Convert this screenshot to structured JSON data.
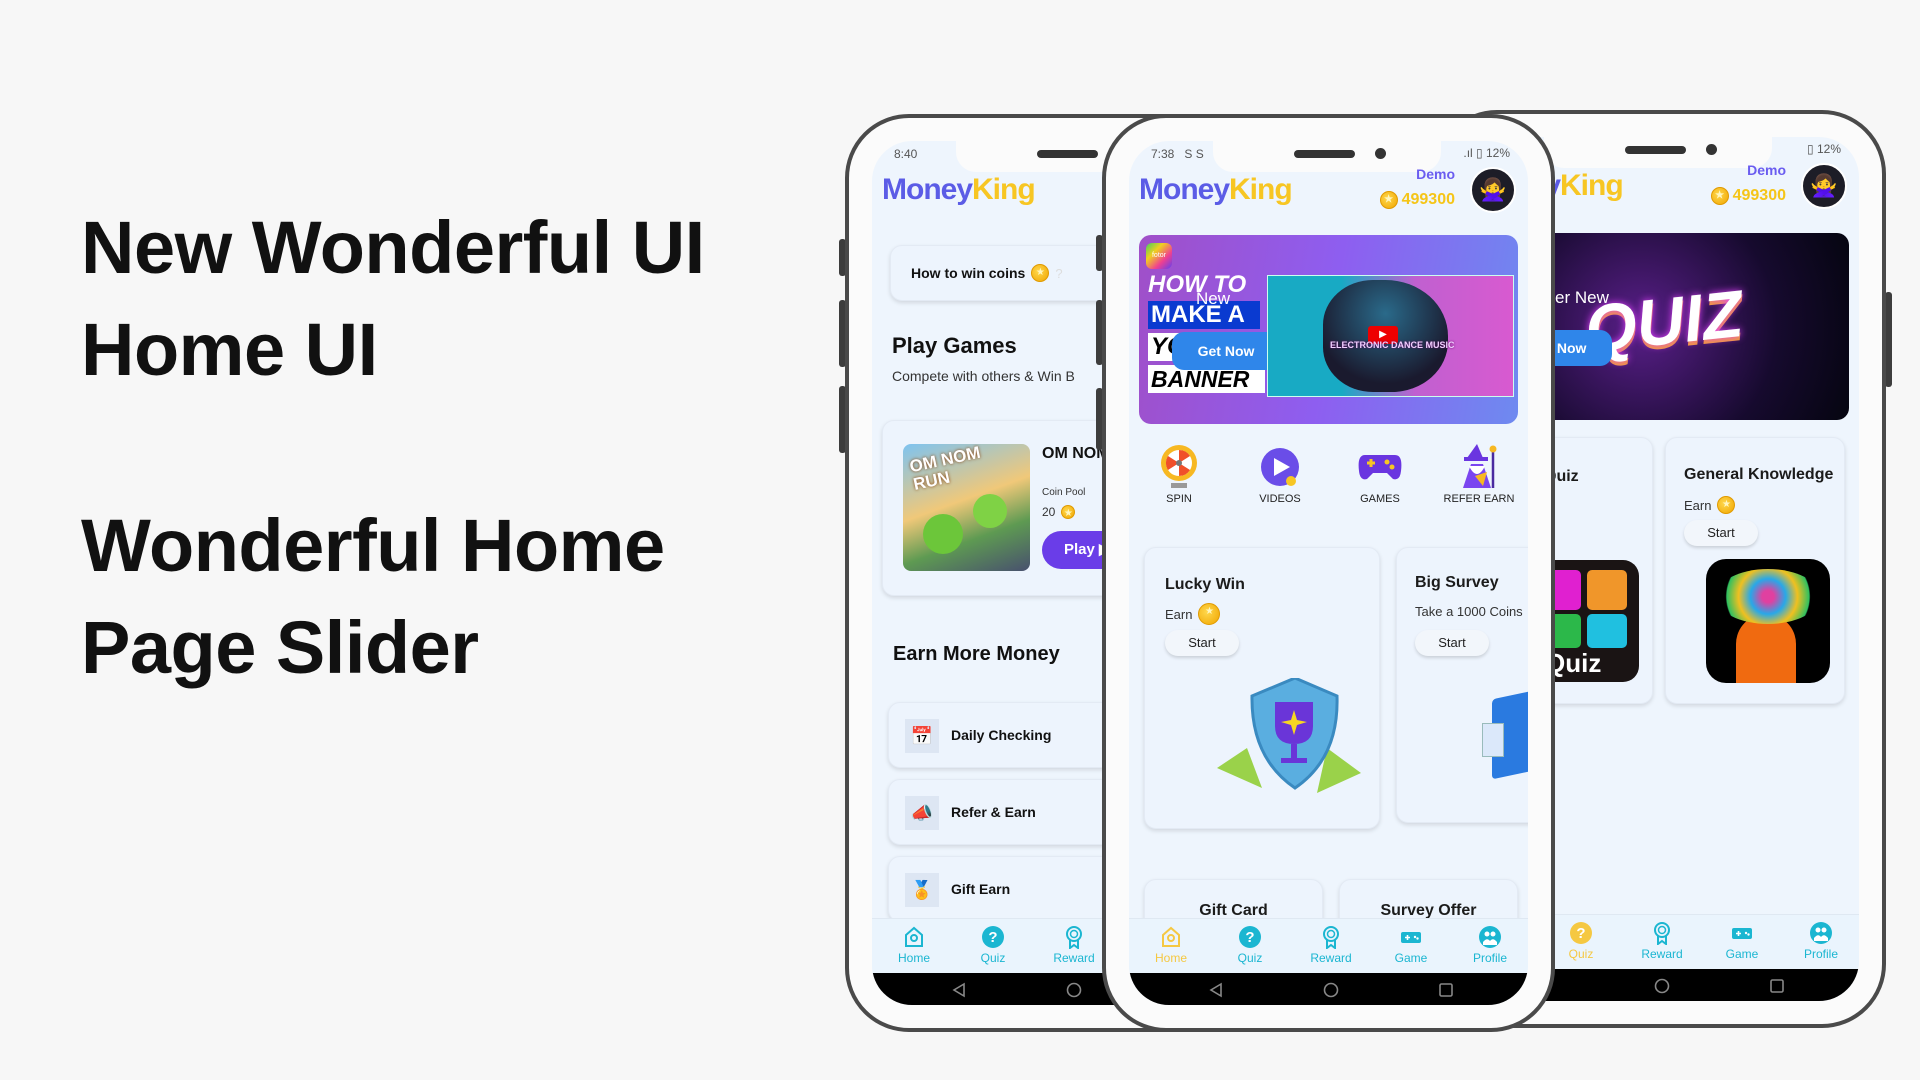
{
  "headline": {
    "line1": "New Wonderful UI",
    "line2": "Home UI",
    "line3": "Wonderful Home",
    "line4": "Page Slider"
  },
  "app": {
    "logo_part1": "Money",
    "logo_part2": "King",
    "user_name": "Demo",
    "coins": "499300",
    "avatar_icon": "person-gesturing-no-emoji",
    "colors": {
      "logo_money": "#5b5ce6",
      "logo_king": "#f7c623",
      "nav_teal": "#1bb6d1",
      "nav_active": "#f5c842",
      "play_button": "#6a3de8",
      "get_now_button": "#2f86ea",
      "screen_bg": "#eef5fd"
    }
  },
  "nav": [
    "Home",
    "Quiz",
    "Reward",
    "Game",
    "Profile"
  ],
  "left_phone": {
    "time": "8:40",
    "how_to_win": "How to win coins",
    "how_to_win_suffix": "?",
    "play_games_title": "Play Games",
    "play_games_subtitle": "Compete with others & Win B",
    "game": {
      "title": "OM NOM",
      "thumb_text": "OM NOM RUN",
      "coin_pool_label": "Coin Pool",
      "coin_pool_value": "20",
      "play_label": "Play ▶"
    },
    "earn_title": "Earn More Money",
    "earn_items": [
      "Daily Checking",
      "Refer & Earn",
      "Gift Earn"
    ],
    "active_nav": "none"
  },
  "middle_phone": {
    "time": "7:38",
    "status_icons": "S S",
    "battery": "12%",
    "banner": {
      "badge": "fotor",
      "line1": "HOW TO",
      "line2": "MAKE A",
      "line3": "YOUR",
      "line4": "BANNER",
      "overlay": "New",
      "button": "Get Now",
      "inner_text": "ELECTRONIC DANCE MUSIC"
    },
    "categories": [
      "SPIN",
      "VIDEOS",
      "GAMES",
      "REFER EARN"
    ],
    "cards": [
      {
        "title": "Lucky Win",
        "subtitle": "Earn",
        "button": "Start"
      },
      {
        "title": "Big Survey",
        "subtitle": "Take a 1000 Coins",
        "button": "Start"
      }
    ],
    "bottom_cards": [
      "Gift Card",
      "Survey Offer"
    ],
    "active_nav": "Home"
  },
  "right_phone": {
    "battery": "12%",
    "banner": {
      "title": "QUIZ",
      "overlay": "er New",
      "button": "Get Now"
    },
    "cards": [
      {
        "title": "Quiz",
        "tile_text": "Quiz"
      },
      {
        "title": "General Knowledge",
        "subtitle": "Earn",
        "button": "Start"
      }
    ],
    "active_nav": "Quiz"
  }
}
